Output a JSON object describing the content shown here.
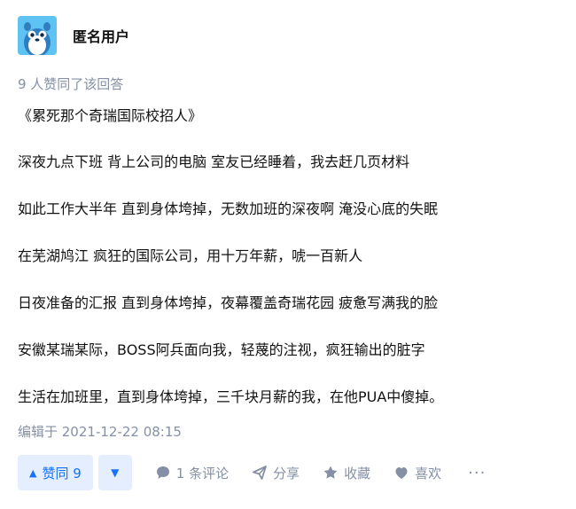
{
  "author": {
    "name": "匿名用户",
    "avatar_icon": "anonymous-avatar-icon"
  },
  "upvote_note": "9 人赞同了该回答",
  "content": {
    "title": "《累死那个奇瑞国际校招人》",
    "lines": [
      "深夜九点下班 背上公司的电脑 室友已经睡着，我去赶几页材料",
      "如此工作大半年 直到身体垮掉，无数加班的深夜啊 淹没心底的失眠",
      "在芜湖鸠江 疯狂的国际公司，用十万年薪，唬一百新人",
      "日夜准备的汇报 直到身体垮掉，夜幕覆盖奇瑞花园 疲惫写满我的脸",
      "安徽某瑞某际，BOSS阿兵面向我，轻蔑的注视，疯狂输出的脏字",
      "生活在加班里，直到身体垮掉，三千块月薪的我，在他PUA中傻掉。"
    ]
  },
  "edited": "编辑于 2021-12-22 08:15",
  "actions": {
    "vote_up_label": "赞同 9",
    "comment_label": "1 条评论",
    "share_label": "分享",
    "favorite_label": "收藏",
    "like_label": "喜欢",
    "more_label": "···"
  },
  "colors": {
    "accent": "#1772f6",
    "accent_bg": "#e5eeff",
    "muted": "#8590a6",
    "avatar_bg": "#5ec3f2"
  }
}
